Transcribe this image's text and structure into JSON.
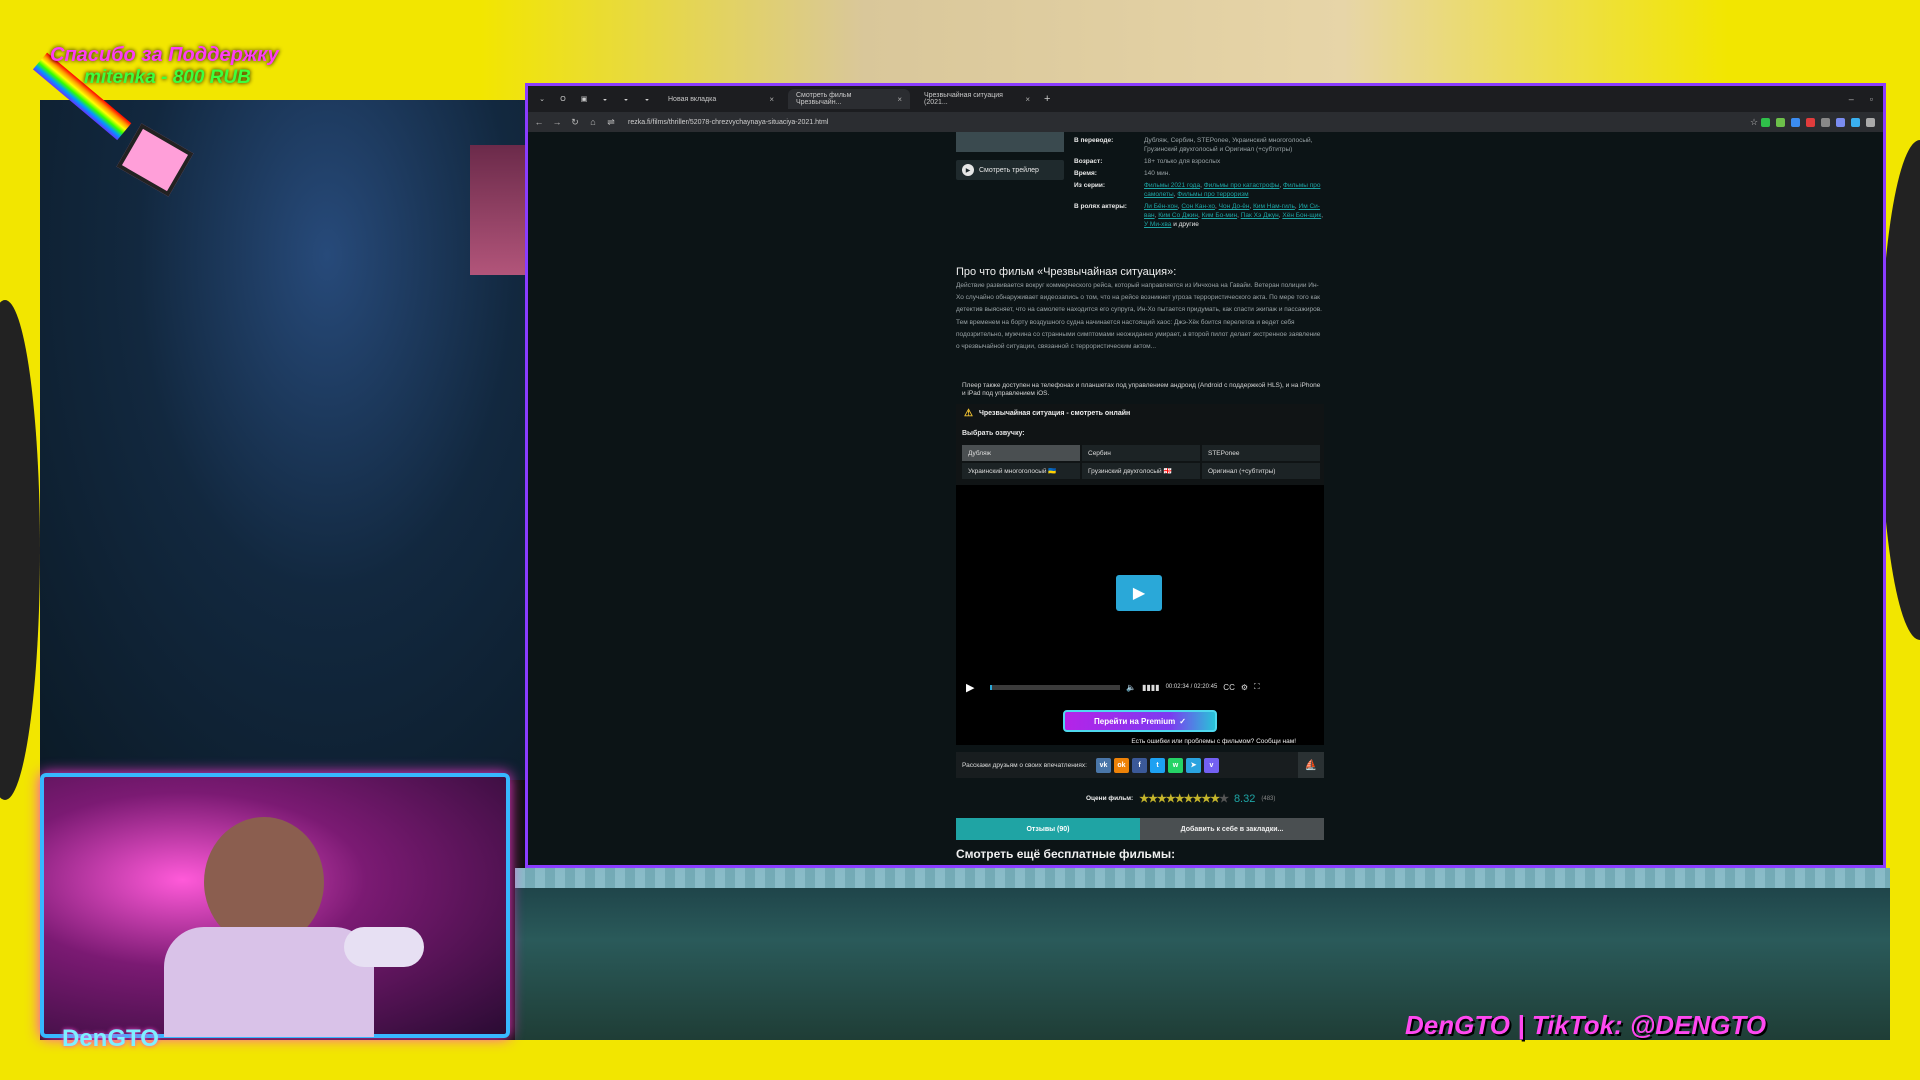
{
  "overlay": {
    "donation_line1": "Спасибо за Поддержку",
    "donation_line2": "mitenka - 800 RUB",
    "cam_logo": "DenGTO",
    "socials": "DenGTO | TikTok: @DENGTO"
  },
  "browser": {
    "tabs": [
      {
        "label": "Новая вкладка",
        "active": false
      },
      {
        "label": "Смотреть фильм Чрезвычайн...",
        "active": true
      },
      {
        "label": "Чрезвычайная ситуация (2021...",
        "active": false
      }
    ],
    "url": "rezka.fi/films/thriller/52078-chrezvychaynaya-situaciya-2021.html"
  },
  "film": {
    "trailer_label": "Смотреть трейлер",
    "info": [
      {
        "key": "В переводе:",
        "value": "Дубляж, Сербин, STEPonee, Украинский многоголосый, Грузинский двухголосый и Оригинал (+субтитры)"
      },
      {
        "key": "Возраст:",
        "value": "18+ только для взрослых"
      },
      {
        "key": "Время:",
        "value": "140 мин."
      }
    ],
    "series_key": "Из серии:",
    "series_links": [
      "Фильмы 2021 года",
      "Фильмы про катастрофы",
      "Фильмы про самолеты",
      "Фильмы про терроризм"
    ],
    "actors_key": "В ролях актеры:",
    "actors": [
      "Ли Бён-хон",
      "Сон Кан-хо",
      "Чон До-ён",
      "Ким Нам-гиль",
      "Им Си-ван",
      "Ким Со Джин",
      "Ким Бо-мин",
      "Пак Хэ Джун",
      "Хён Бон-щик",
      "У Ми-хва"
    ],
    "actors_suffix": "и другие",
    "about_title": "Про что фильм «Чрезвычайная ситуация»:",
    "about_text": "Действие развивается вокруг коммерческого рейса, который направляется из Инчхона на Гавайи. Ветеран полиции Ин-Хо случайно обнаруживает видеозапись о том, что на рейсе возникнет угроза террористического акта. По мере того как детектив выясняет, что на самолете находится его супруга, Ин-Хо пытается придумать, как спасти экипаж и пассажиров. Тем временем на борту воздушного судна начинается настоящий хаос: Джэ-Хёк боится перелетов и ведет себя подозрительно, мужчина со странными симптомами неожиданно умирает, а второй пилот делает экстренное заявление о чрезвычайной ситуации, связанной с террористическим актом...",
    "player_note": "Плеер также доступен на телефонах и планшетах под управлением андроид (Android с поддержкой HLS), и на iPhone и iPad под управлением iOS."
  },
  "player": {
    "warning_title": "Чрезвычайная ситуация - смотреть онлайн",
    "voice_label": "Выбрать озвучку:",
    "voices": [
      {
        "label": "Дубляж",
        "selected": true
      },
      {
        "label": "Сербин",
        "selected": false
      },
      {
        "label": "STEPonee",
        "selected": false
      },
      {
        "label": "Украинский многоголосый 🇺🇦",
        "selected": false
      },
      {
        "label": "Грузинский двухголосый 🇬🇪",
        "selected": false
      },
      {
        "label": "Оригинал (+субтитры)",
        "selected": false
      }
    ],
    "time": "00:02:34 / 02:20:45",
    "progress": 0.018,
    "premium_label": "Перейти на Premium",
    "report_text": "Есть ошибки или проблемы с фильмом? Сообщи нам!"
  },
  "share": {
    "label": "Расскажи друзьям о своих впечатлениях:",
    "networks": [
      {
        "name": "vk",
        "glyph": "vk",
        "color": "#4a76a8"
      },
      {
        "name": "ok",
        "glyph": "ok",
        "color": "#ee8208"
      },
      {
        "name": "facebook",
        "glyph": "f",
        "color": "#3b5998"
      },
      {
        "name": "twitter",
        "glyph": "t",
        "color": "#1da1f2"
      },
      {
        "name": "whatsapp",
        "glyph": "w",
        "color": "#25d366"
      },
      {
        "name": "telegram",
        "glyph": "➤",
        "color": "#2aa3df"
      },
      {
        "name": "viber",
        "glyph": "v",
        "color": "#7360f2"
      }
    ]
  },
  "rating": {
    "label": "Оцени фильм:",
    "score": "8.32",
    "votes": "(483)",
    "stars_on": 9,
    "stars_total": 10
  },
  "buttons": {
    "reviews": "Отзывы (90)",
    "bookmark": "Добавить к себе в закладки..."
  },
  "more_title": "Смотреть ещё бесплатные фильмы:"
}
